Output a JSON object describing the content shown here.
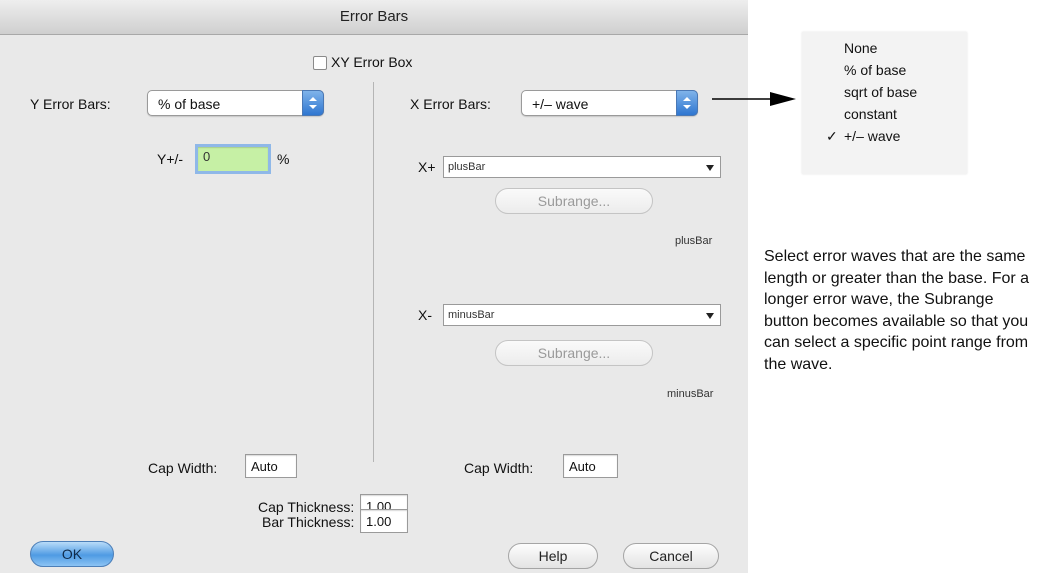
{
  "dialog": {
    "title": "Error Bars",
    "xy_error_box": {
      "label": "XY Error Box",
      "checked": false
    },
    "y": {
      "label": "Y Error Bars:",
      "mode": "% of base",
      "plusminus_label": "Y+/-",
      "plusminus_value": "0",
      "unit": "%",
      "cap_width_label": "Cap Width:",
      "cap_width_value": "Auto"
    },
    "x": {
      "label": "X Error Bars:",
      "mode": "+/– wave",
      "plus_label": "X+",
      "plus_wave": "plusBar",
      "plus_subrange": "Subrange...",
      "plus_caption": "plusBar",
      "minus_label": "X-",
      "minus_wave": "minusBar",
      "minus_subrange": "Subrange...",
      "minus_caption": "minusBar",
      "cap_width_label": "Cap Width:",
      "cap_width_value": "Auto"
    },
    "cap_thickness_label": "Cap Thickness:",
    "cap_thickness_value": "1.00",
    "bar_thickness_label": "Bar Thickness:",
    "bar_thickness_value": "1.00",
    "buttons": {
      "ok": "OK",
      "help": "Help",
      "cancel": "Cancel"
    }
  },
  "menu": {
    "items": [
      {
        "label": "None",
        "checked": false
      },
      {
        "label": "% of base",
        "checked": false
      },
      {
        "label": "sqrt of base",
        "checked": false
      },
      {
        "label": "constant",
        "checked": false
      },
      {
        "label": "+/– wave",
        "checked": true,
        "check_glyph": "✓"
      }
    ]
  },
  "note": "Select error waves that are the same length or greater than the base. For a longer error wave, the Subrange button becomes available so that you can select a specific point range from the wave."
}
